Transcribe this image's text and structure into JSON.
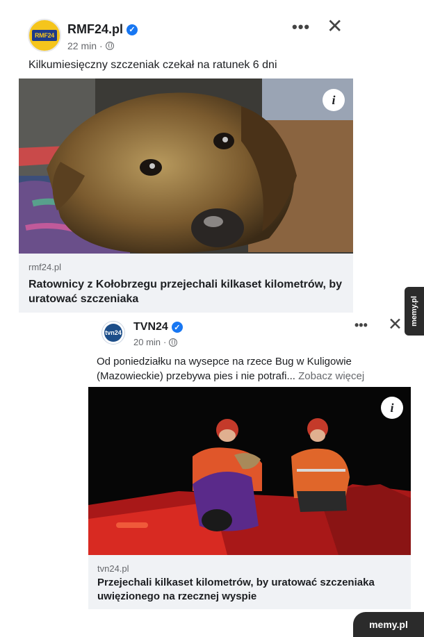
{
  "post1": {
    "author": "RMF24.pl",
    "avatar_text": "RMF24",
    "time": "22 min",
    "separator": "·",
    "text": "Kilkumiesięczny szczeniak czekał na ratunek 6 dni",
    "link_domain": "rmf24.pl",
    "link_title": "Ratownicy z Kołobrzegu przejechali kilkaset kilometrów, by uratować szczeniaka",
    "info_glyph": "i",
    "more_glyph": "•••",
    "close_glyph": "✕",
    "image_icon": "puppy-photo"
  },
  "post2": {
    "author": "TVN24",
    "avatar_text": "tvn24",
    "time": "20 min",
    "separator": "·",
    "text": "Od poniedziałku na wysepce na rzece Bug w Kuligowie (Mazowieckie) przebywa pies i nie potrafi...",
    "see_more": "Zobacz więcej",
    "link_domain": "tvn24.pl",
    "link_title": "Przejechali kilkaset kilometrów, by uratować szczeniaka uwięzionego na rzecznej wyspie",
    "info_glyph": "i",
    "more_glyph": "•••",
    "close_glyph": "✕",
    "image_icon": "rescuers-photo"
  },
  "watermark": {
    "side": "memy.pl",
    "corner": "memy.pl"
  },
  "colors": {
    "verified": "#1877f2",
    "link_bg": "#f0f2f5",
    "meta_text": "#65676b",
    "watermark_bg": "#2b2b2b"
  }
}
